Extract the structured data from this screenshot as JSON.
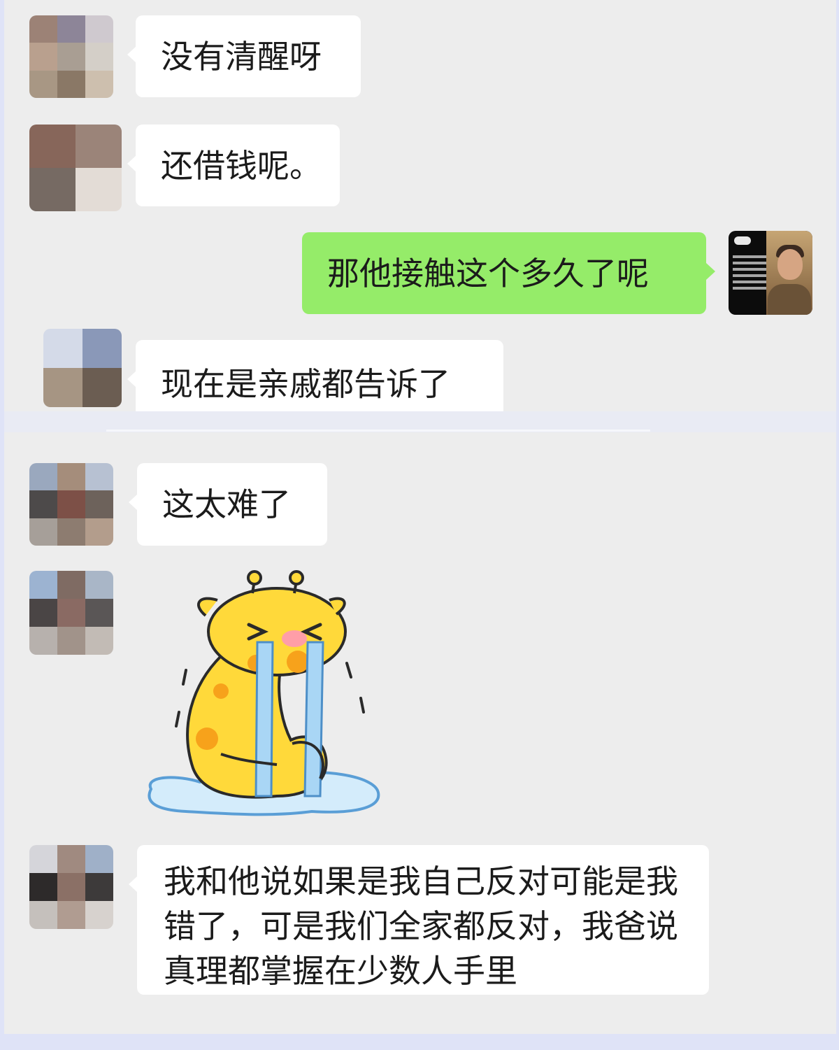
{
  "messages": [
    {
      "side": "left",
      "text": "没有清醒呀",
      "avatar_icon": "blurred-avatar-icon"
    },
    {
      "side": "left",
      "text": "还借钱呢。",
      "avatar_icon": "blurred-avatar-icon"
    },
    {
      "side": "right",
      "text": "那他接触这个多久了呢",
      "avatar_icon": "tv-news-avatar-icon"
    },
    {
      "side": "left",
      "text": "现在是亲戚都告诉了",
      "avatar_icon": "blurred-avatar-icon"
    },
    {
      "side": "left",
      "text": "这太难了",
      "avatar_icon": "blurred-avatar-icon"
    },
    {
      "side": "left",
      "type": "sticker",
      "sticker_icon": "crying-giraffe-sticker-icon"
    },
    {
      "side": "left",
      "text": "我和他说如果是我自己反对可能是我错了，可是我们全家都反对，我爸说真理都掌握在少数人手里",
      "avatar_icon": "blurred-avatar-icon"
    }
  ],
  "colors": {
    "chat_background": "#ededed",
    "incoming_bubble": "#ffffff",
    "outgoing_bubble": "#95ec69",
    "page_border": "#dfe3f7",
    "sticker_yellow": "#ffd93a",
    "sticker_spots": "#f7a21b",
    "sticker_tears": "#a9d6f5"
  }
}
